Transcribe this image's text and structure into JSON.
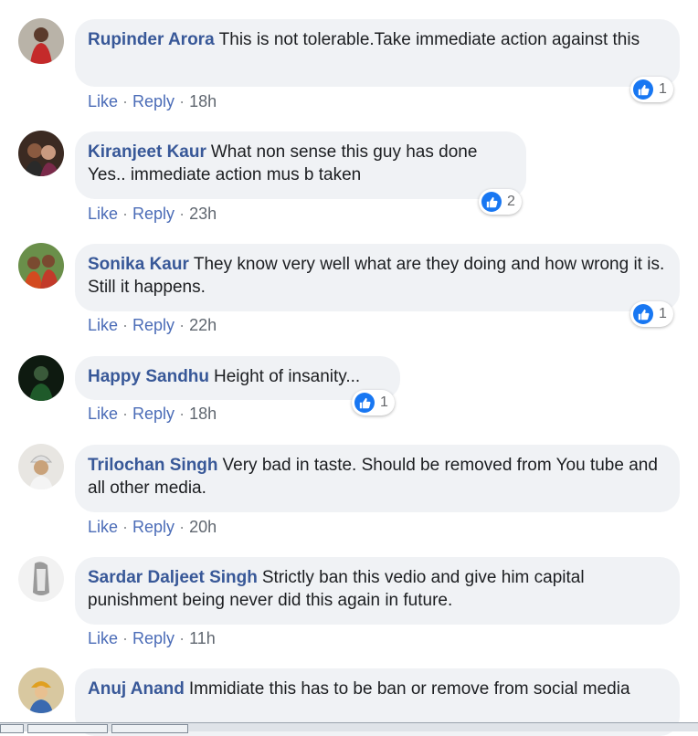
{
  "comments": [
    {
      "author": "Rupinder Arora",
      "text": "This is not tolerable.Take immediate action against this",
      "like": "Like",
      "reply": "Reply",
      "time": "18h",
      "reactions": "1",
      "avatar_color": "#c42a2a"
    },
    {
      "author": "Kiranjeet Kaur",
      "text": "What non sense this guy has done Yes.. immediate action mus b taken",
      "like": "Like",
      "reply": "Reply",
      "time": "23h",
      "reactions": "2",
      "avatar_color": "#6b4a3a"
    },
    {
      "author": "Sonika Kaur",
      "text": "They know very well what are they doing and how wrong it is. Still it happens.",
      "like": "Like",
      "reply": "Reply",
      "time": "22h",
      "reactions": "1",
      "avatar_color": "#d34a1f"
    },
    {
      "author": "Happy Sandhu",
      "text": "Height of insanity...",
      "like": "Like",
      "reply": "Reply",
      "time": "18h",
      "reactions": "1",
      "avatar_color": "#1f5a2a"
    },
    {
      "author": "Trilochan Singh",
      "text": "Very bad in taste. Should be removed from You tube and all other media.",
      "like": "Like",
      "reply": "Reply",
      "time": "20h",
      "reactions": "",
      "avatar_color": "#c9a27a"
    },
    {
      "author": "Sardar Daljeet Singh",
      "text": "Strictly ban this vedio and give him capital punishment being never did this again in future.",
      "like": "Like",
      "reply": "Reply",
      "time": "11h",
      "reactions": "",
      "avatar_color": "#9a9a9a"
    },
    {
      "author": "Anuj Anand",
      "text": "Immidiate this has to be ban or remove from social media",
      "like": "",
      "reply": "",
      "time": "",
      "reactions": "",
      "avatar_color": "#e0a020"
    }
  ],
  "colors": {
    "author": "#385898",
    "bubble": "#f0f2f5",
    "link": "#4b6cb7",
    "like_badge": "#1877f2"
  }
}
